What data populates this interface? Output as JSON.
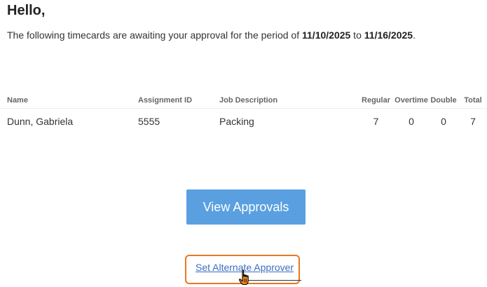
{
  "greeting": "Hello,",
  "intro": {
    "prefix": "The following timecards are awaiting your approval for the period of ",
    "start_date": "11/10/2025",
    "connector": " to ",
    "end_date": "11/16/2025",
    "suffix": "."
  },
  "table": {
    "headers": {
      "name": "Name",
      "assignment_id": "Assignment ID",
      "job_description": "Job Description",
      "regular": "Regular",
      "overtime": "Overtime",
      "double": "Double",
      "total": "Total"
    },
    "rows": [
      {
        "name": "Dunn, Gabriela",
        "assignment_id": "5555",
        "job_description": "Packing",
        "regular": "7",
        "overtime": "0",
        "double": "0",
        "total": "7"
      }
    ]
  },
  "actions": {
    "view_approvals": "View Approvals",
    "set_alternate_approver": "Set Alternate Approver"
  },
  "colors": {
    "button": "#5aa0e0",
    "link": "#3a6fc4",
    "highlight": "#e87722"
  },
  "cursor": "hand-pointer-icon"
}
